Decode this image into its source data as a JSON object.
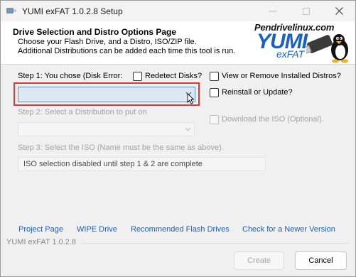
{
  "window": {
    "title": "YUMI exFAT 1.0.2.8 Setup"
  },
  "header": {
    "title": "Drive Selection and Distro Options Page",
    "line1": "Choose your Flash Drive, and a Distro, ISO/ZIP file.",
    "line2": "Additional Distributions can be added each time this tool is run.",
    "logo_site": "Pendrivelinux.com",
    "logo_name": "YUMI",
    "logo_sub": "exFAT"
  },
  "step1": {
    "label": "Step 1: You chose (Disk Error:",
    "redetect_label": "Redetect Disks?",
    "drive_value": ""
  },
  "options": {
    "view_remove_label": "View or Remove Installed Distros?",
    "reinstall_label": "Reinstall or Update?",
    "download_iso_label": "Download the ISO (Optional)."
  },
  "step2": {
    "label": "Step 2: Select a Distribution to put on",
    "value": ""
  },
  "step3": {
    "label": "Step 3: Select the ISO (Name must be the same as above).",
    "iso_field_text": "ISO selection disabled until step 1 & 2 are complete"
  },
  "links": {
    "project_page": "Project Page",
    "wipe_drive": "WIPE Drive",
    "recommended_drives": "Recommended Flash Drives",
    "check_newer": "Check for a Newer Version"
  },
  "footer": {
    "version": "YUMI exFAT 1.0.2.8"
  },
  "buttons": {
    "create": "Create",
    "cancel": "Cancel"
  },
  "icons": {
    "app": "usb-drive-icon",
    "minimize": "minimize-icon",
    "maximize": "maximize-icon",
    "close": "close-icon",
    "dropdown": "chevron-down-icon",
    "logo_mascot": "penguin-usb-logo",
    "cursor": "mouse-pointer-icon"
  },
  "colors": {
    "link": "#1e5fb4",
    "highlight": "#d93a3a",
    "logo_blue": "#1763c4"
  }
}
